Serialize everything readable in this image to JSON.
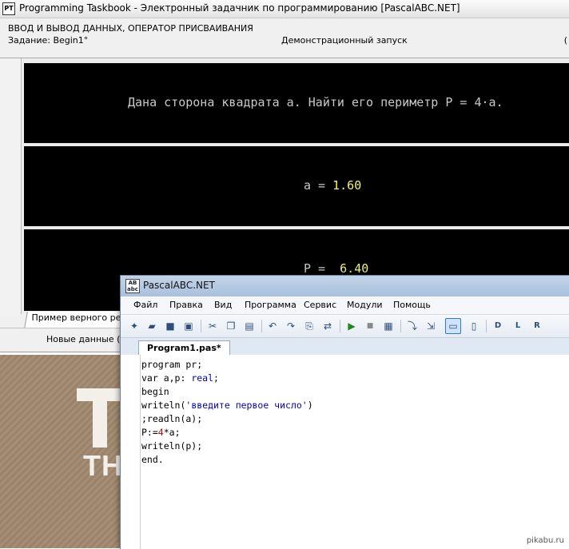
{
  "taskbook": {
    "title": "Programming Taskbook - Электронный задачник по программированию [PascalABC.NET]",
    "icon_label": "PT",
    "topic": "ВВОД И ВЫВОД ДАННЫХ, ОПЕРАТОР ПРИСВАИВАНИЯ",
    "task": "Задание: Begin1°",
    "mode": "Демонстрационный запуск",
    "edge_label": "(",
    "task_text": "Дана сторона квадрата a. Найти его периметр P = 4·a.",
    "input_label": "a = ",
    "input_value": "1.60",
    "output_label": "P = ",
    "output_value": " 6.40",
    "tab_label": "Пример верного решения",
    "new_data_button": "Новые данные (Space)"
  },
  "pascal": {
    "title": "PascalABC.NET",
    "icon_label": "AB abc",
    "menu": [
      "Файл",
      "Правка",
      "Вид",
      "Программа",
      "Сервис",
      "Модули",
      "Помощь"
    ],
    "toolbar": [
      {
        "name": "new-file-icon",
        "glyph": "✦"
      },
      {
        "name": "open-folder-icon",
        "glyph": "▰"
      },
      {
        "name": "save-icon",
        "glyph": "■"
      },
      {
        "name": "save-all-icon",
        "glyph": "▣"
      },
      {
        "name": "cut-icon",
        "glyph": "✂"
      },
      {
        "name": "copy-icon",
        "glyph": "❐"
      },
      {
        "name": "paste-icon",
        "glyph": "▤"
      },
      {
        "name": "undo-icon",
        "glyph": "↶"
      },
      {
        "name": "redo-icon",
        "glyph": "↷"
      },
      {
        "name": "find-icon",
        "glyph": "⎘"
      },
      {
        "name": "replace-icon",
        "glyph": "⇄"
      },
      {
        "name": "run-icon",
        "glyph": "▶"
      },
      {
        "name": "stop-icon",
        "glyph": "■"
      },
      {
        "name": "compile-icon",
        "glyph": "▦"
      },
      {
        "name": "debug-step-icon",
        "glyph": "⤵"
      },
      {
        "name": "debug-step-over-icon",
        "glyph": "⇲"
      },
      {
        "name": "console-icon",
        "glyph": "▭"
      },
      {
        "name": "output-window-icon",
        "glyph": "▯"
      },
      {
        "name": "taskbook-d-icon",
        "glyph": "D"
      },
      {
        "name": "taskbook-l-icon",
        "glyph": "L"
      },
      {
        "name": "taskbook-r-icon",
        "glyph": "R"
      }
    ],
    "tab_label": "Program1.pas*",
    "code": [
      "program pr;",
      "var a,p: real;",
      "begin",
      "writeln('введите первое число')",
      ";readln(a);",
      "P:=4*a;",
      "writeln(p);",
      "end."
    ]
  },
  "wallpaper_text": "TH",
  "watermark": "pikabu.ru"
}
